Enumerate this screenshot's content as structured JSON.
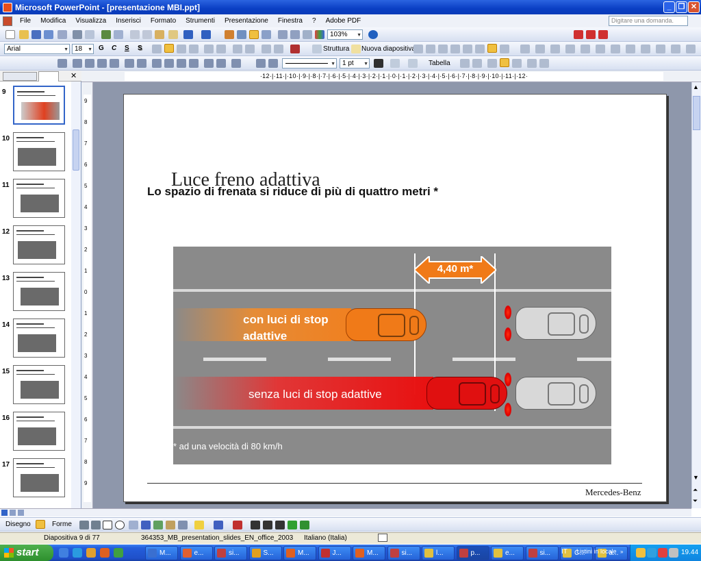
{
  "window": {
    "title": "Microsoft PowerPoint - [presentazione MBI.ppt]",
    "buttons": {
      "minimize": "_",
      "restore": "❐",
      "close": "✕"
    }
  },
  "menu": {
    "items": [
      "File",
      "Modifica",
      "Visualizza",
      "Inserisci",
      "Formato",
      "Strumenti",
      "Presentazione",
      "Finestra",
      "?",
      "Adobe PDF"
    ],
    "ask_placeholder": "Digitare una domanda."
  },
  "toolbar_standard": {
    "zoom": "103%"
  },
  "toolbar_format": {
    "font": "Arial",
    "size": "18",
    "bold": "G",
    "italic": "C",
    "underline": "S",
    "shadow": "S",
    "struttura": "Struttura",
    "nuova_diapositiva": "Nuova diapositiva"
  },
  "toolbar_table": {
    "line_weight": "1 pt",
    "tabella": "Tabella"
  },
  "ruler": {
    "horizontal": "·12·|·11·|·10·|·9·|·8·|·7·|·6·|·5·|·4·|·3·|·2·|·1·|·0·|·1·|·2·|·3·|·4·|·5·|·6·|·7·|·8·|·9·|·10·|·11·|·12·",
    "vertical": [
      "9",
      "8",
      "7",
      "6",
      "5",
      "4",
      "3",
      "2",
      "1",
      "0",
      "1",
      "2",
      "3",
      "4",
      "5",
      "6",
      "7",
      "8",
      "9"
    ]
  },
  "slides_pane": {
    "thumbnails": [
      {
        "number": "9",
        "selected": true
      },
      {
        "number": "10",
        "selected": false
      },
      {
        "number": "11",
        "selected": false
      },
      {
        "number": "12",
        "selected": false
      },
      {
        "number": "13",
        "selected": false
      },
      {
        "number": "14",
        "selected": false
      },
      {
        "number": "15",
        "selected": false
      },
      {
        "number": "16",
        "selected": false
      },
      {
        "number": "17",
        "selected": false
      }
    ]
  },
  "slide": {
    "title": "Luce freno adattiva",
    "subtitle": "Lo spazio di frenata si riduce di più di quattro metri  *",
    "distance": "4,40 m*",
    "label_with": "con luci di stop adattive",
    "label_without": "senza luci di stop adattive",
    "footnote": "* ad una velocità di 80 km/h",
    "brand": "Mercedes-Benz"
  },
  "drawing_toolbar": {
    "disegno": "Disegno",
    "forme": "Forme"
  },
  "status": {
    "slide_info": "Diapositiva 9 di 77",
    "template": "364353_MB_presentation_slides_EN_office_2003",
    "language": "Italiano (Italia)"
  },
  "taskbar": {
    "start": "start",
    "tasks": [
      "M...",
      "e...",
      "si...",
      "S...",
      "M...",
      "J...",
      "M...",
      "si...",
      "l...",
      "p...",
      "e...",
      "si...",
      "C...",
      "a..."
    ],
    "lang": "IT",
    "listini": "Listini in locale",
    "time": "19.44"
  },
  "colors": {
    "accent_orange": "#f08020",
    "accent_red": "#e81010",
    "title_blue": "#0a3fc4"
  }
}
